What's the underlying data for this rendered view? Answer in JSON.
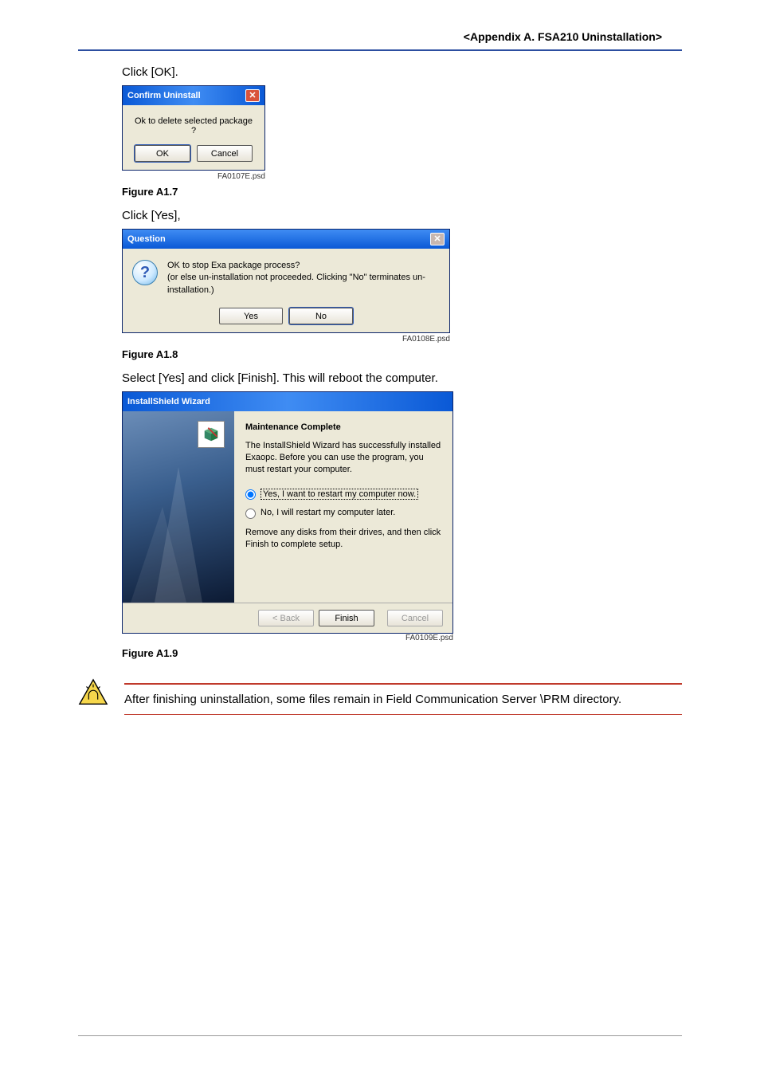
{
  "header": {
    "title": "<Appendix A.  FSA210 Uninstallation>"
  },
  "steps": {
    "s1": "Click [OK].",
    "s2": "Click [Yes],",
    "s3": "Select [Yes] and click [Finish]. This will reboot the computer."
  },
  "figures": {
    "f1": {
      "caption": "Figure A1.7",
      "psd": "FA0107E.psd"
    },
    "f2": {
      "caption": "Figure A1.8",
      "psd": "FA0108E.psd"
    },
    "f3": {
      "caption": "Figure A1.9",
      "psd": "FA0109E.psd"
    }
  },
  "dialog1": {
    "title": "Confirm Uninstall",
    "message": "Ok to delete selected package ?",
    "ok": "OK",
    "cancel": "Cancel"
  },
  "dialog2": {
    "title": "Question",
    "line1": "OK to stop Exa package process?",
    "line2": "(or else un-installation not proceeded. Clicking \"No\" terminates un-installation.)",
    "yes": "Yes",
    "no": "No"
  },
  "wizard": {
    "title": "InstallShield Wizard",
    "heading": "Maintenance Complete",
    "para1": "The InstallShield Wizard has successfully installed Exaopc. Before you can use the program, you must restart your computer.",
    "opt_yes": "Yes, I want to restart my computer now.",
    "opt_no": "No, I will restart my computer later.",
    "para2": "Remove any disks from their drives, and then click Finish to complete setup.",
    "back": "< Back",
    "finish": "Finish",
    "cancel": "Cancel"
  },
  "caution": {
    "text": "After finishing uninstallation, some files remain in Field Communication Server \\PRM directory."
  }
}
